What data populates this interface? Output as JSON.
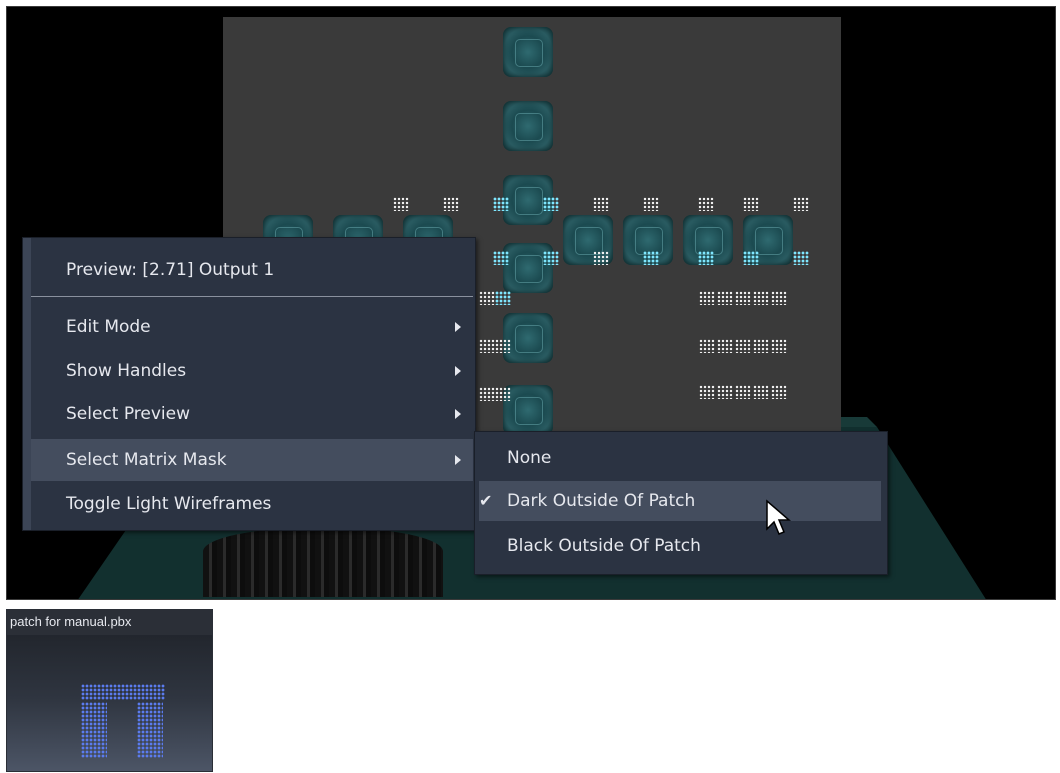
{
  "viewport": {
    "context_menu": {
      "header": "Preview: [2.71] Output 1",
      "items": [
        {
          "label": "Edit Mode",
          "submenu": true
        },
        {
          "label": "Show Handles",
          "submenu": true
        },
        {
          "label": "Select Preview",
          "submenu": true
        },
        {
          "label": "Select Matrix Mask",
          "submenu": true,
          "highlighted": true
        },
        {
          "label": "Toggle Light Wireframes",
          "submenu": false
        }
      ]
    },
    "matrix_mask_submenu": {
      "items": [
        {
          "label": "None",
          "checked": false
        },
        {
          "label": "Dark Outside Of Patch",
          "checked": true,
          "highlighted": true
        },
        {
          "label": "Black Outside Of Patch",
          "checked": false
        }
      ],
      "check_glyph": "✔"
    }
  },
  "thumbnail": {
    "title": "patch for manual.pbx"
  },
  "colors": {
    "menu_bg": "#2b3342",
    "menu_highlight": "#444d5e",
    "stage_gray": "#3a3a3a",
    "tile_teal": "#2f6a70",
    "dot_blue": "#5b7cf0"
  },
  "icons": [
    "submenu-arrow-icon",
    "checkmark-icon",
    "mouse-pointer-icon"
  ]
}
